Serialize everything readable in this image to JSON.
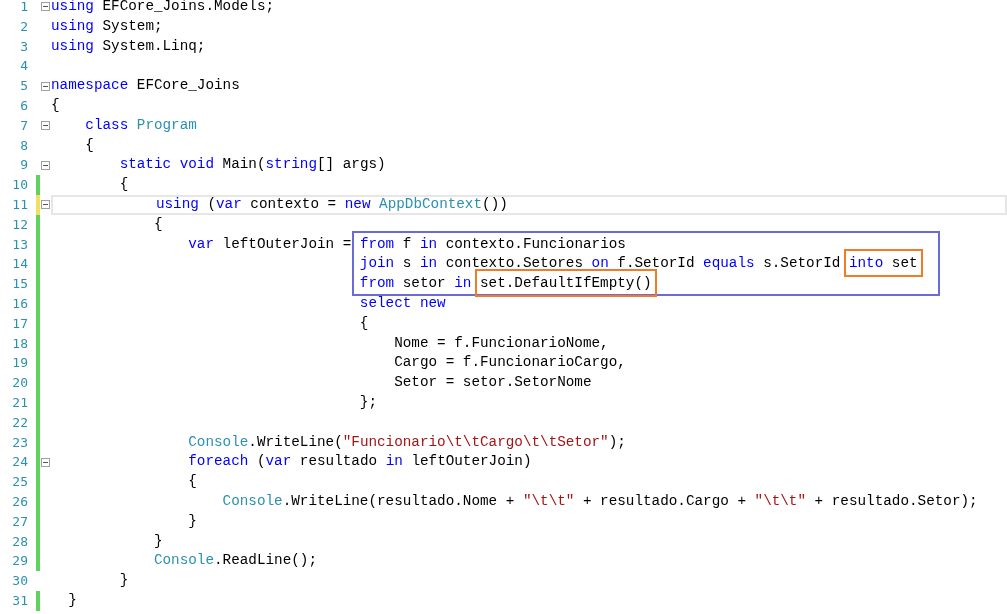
{
  "highlights": [
    {
      "kind": "frame",
      "color": "#6b6bd8"
    },
    {
      "kind": "box",
      "color": "#f07c28"
    }
  ],
  "lines": [
    {
      "number": "1",
      "fold": true,
      "current": false,
      "tokens": [
        {
          "text": "using",
          "kind": "kw"
        },
        {
          "text": " EFCore_Joins.Models;",
          "kind": "plain"
        }
      ]
    },
    {
      "number": "2",
      "fold": false,
      "current": false,
      "tokens": [
        {
          "text": "using",
          "kind": "kw"
        },
        {
          "text": " System;",
          "kind": "plain"
        }
      ]
    },
    {
      "number": "3",
      "fold": false,
      "current": false,
      "tokens": [
        {
          "text": "using",
          "kind": "kw"
        },
        {
          "text": " System.Linq;",
          "kind": "plain"
        }
      ]
    },
    {
      "number": "4",
      "fold": false,
      "current": false
    },
    {
      "number": "5",
      "fold": true,
      "current": false,
      "tokens": [
        {
          "text": "namespace",
          "kind": "kw"
        },
        {
          "text": " EFCore_Joins",
          "kind": "plain"
        }
      ]
    },
    {
      "number": "6",
      "fold": false,
      "current": false,
      "tokens": [
        {
          "text": "{",
          "kind": "plain"
        }
      ]
    },
    {
      "number": "7",
      "fold": true,
      "current": false,
      "tokens": [
        {
          "text": "    class",
          "kind": "kw"
        },
        {
          "text": " Program",
          "kind": "type"
        }
      ]
    },
    {
      "number": "8",
      "fold": false,
      "current": false,
      "tokens": [
        {
          "text": "    {",
          "kind": "plain"
        }
      ]
    },
    {
      "number": "9",
      "fold": true,
      "current": false,
      "tokens": [
        {
          "text": "        static",
          "kind": "kw"
        },
        {
          "text": " void",
          "kind": "kw"
        },
        {
          "text": " Main(",
          "kind": "plain"
        },
        {
          "text": "string",
          "kind": "kw"
        },
        {
          "text": "[] args)",
          "kind": "plain"
        }
      ]
    },
    {
      "number": "10",
      "fold": false,
      "current": false,
      "color": "#5fd35f",
      "tokens": [
        {
          "text": "        {",
          "kind": "plain"
        }
      ]
    },
    {
      "number": "11",
      "fold": true,
      "current": true,
      "color": "#f0e060",
      "tokens": [
        {
          "text": "            using",
          "kind": "kw"
        },
        {
          "text": " (",
          "kind": "plain"
        },
        {
          "text": "var",
          "kind": "kw"
        },
        {
          "text": " contexto = ",
          "kind": "plain"
        },
        {
          "text": "new",
          "kind": "kw"
        },
        {
          "text": " AppDbContext",
          "kind": "type"
        },
        {
          "text": "())",
          "kind": "plain"
        }
      ]
    },
    {
      "number": "12",
      "fold": false,
      "current": false,
      "color": "#5fd35f",
      "tokens": [
        {
          "text": "            {",
          "kind": "plain"
        }
      ]
    },
    {
      "number": "13",
      "fold": false,
      "current": false,
      "color": "#5fd35f",
      "tokens": [
        {
          "text": "                var",
          "kind": "kw"
        },
        {
          "text": " leftOuterJoin = ",
          "kind": "plain"
        }
      ],
      "framed_tokens": [
        {
          "text": "from",
          "kind": "kw"
        },
        {
          "text": " f ",
          "kind": "plain"
        },
        {
          "text": "in",
          "kind": "kw"
        },
        {
          "text": " contexto.Funcionarios",
          "kind": "plain"
        }
      ]
    },
    {
      "number": "14",
      "fold": false,
      "current": false,
      "color": "#5fd35f",
      "framed_tokens": [
        {
          "text": "                                    join",
          "kind": "kw"
        },
        {
          "text": " s ",
          "kind": "plain"
        },
        {
          "text": "in",
          "kind": "kw"
        },
        {
          "text": " contexto.Setores ",
          "kind": "plain"
        },
        {
          "text": "on",
          "kind": "kw"
        },
        {
          "text": " f.SetorId ",
          "kind": "plain"
        },
        {
          "text": "equals",
          "kind": "kw"
        },
        {
          "text": " s.SetorId ",
          "kind": "plain"
        }
      ],
      "boxed_tokens": [
        {
          "text": "into",
          "kind": "kw"
        },
        {
          "text": " set",
          "kind": "plain"
        }
      ]
    },
    {
      "number": "15",
      "fold": false,
      "current": false,
      "color": "#5fd35f",
      "framed_tokens": [
        {
          "text": "                                    from",
          "kind": "kw"
        },
        {
          "text": " setor ",
          "kind": "plain"
        },
        {
          "text": "in ",
          "kind": "kw"
        }
      ],
      "boxed_tokens": [
        {
          "text": "set.DefaultIfEmpty()",
          "kind": "plain"
        }
      ]
    },
    {
      "number": "16",
      "fold": false,
      "current": false,
      "color": "#5fd35f",
      "tokens": [
        {
          "text": "                                    select",
          "kind": "kw"
        },
        {
          "text": " new",
          "kind": "kw"
        }
      ]
    },
    {
      "number": "17",
      "fold": false,
      "current": false,
      "color": "#5fd35f",
      "tokens": [
        {
          "text": "                                    {",
          "kind": "plain"
        }
      ]
    },
    {
      "number": "18",
      "fold": false,
      "current": false,
      "color": "#5fd35f",
      "tokens": [
        {
          "text": "                                        Nome = f.FuncionarioNome,",
          "kind": "plain"
        }
      ]
    },
    {
      "number": "19",
      "fold": false,
      "current": false,
      "color": "#5fd35f",
      "tokens": [
        {
          "text": "                                        Cargo = f.FuncionarioCargo,",
          "kind": "plain"
        }
      ]
    },
    {
      "number": "20",
      "fold": false,
      "current": false,
      "color": "#5fd35f",
      "tokens": [
        {
          "text": "                                        Setor = setor.SetorNome",
          "kind": "plain"
        }
      ]
    },
    {
      "number": "21",
      "fold": false,
      "current": false,
      "color": "#5fd35f",
      "tokens": [
        {
          "text": "                                    };",
          "kind": "plain"
        }
      ]
    },
    {
      "number": "22",
      "fold": false,
      "current": false,
      "color": "#5fd35f"
    },
    {
      "number": "23",
      "fold": false,
      "current": false,
      "color": "#5fd35f",
      "tokens": [
        {
          "text": "                Console",
          "kind": "type"
        },
        {
          "text": ".WriteLine(",
          "kind": "plain"
        },
        {
          "text": "\"Funcionario\\t\\tCargo\\t\\tSetor\"",
          "kind": "str"
        },
        {
          "text": ");",
          "kind": "plain"
        }
      ]
    },
    {
      "number": "24",
      "fold": true,
      "current": false,
      "color": "#5fd35f",
      "tokens": [
        {
          "text": "                foreach",
          "kind": "kw"
        },
        {
          "text": " (",
          "kind": "plain"
        },
        {
          "text": "var",
          "kind": "kw"
        },
        {
          "text": " resultado ",
          "kind": "plain"
        },
        {
          "text": "in",
          "kind": "kw"
        },
        {
          "text": " leftOuterJoin)",
          "kind": "plain"
        }
      ]
    },
    {
      "number": "25",
      "fold": false,
      "current": false,
      "color": "#5fd35f",
      "tokens": [
        {
          "text": "                {",
          "kind": "plain"
        }
      ]
    },
    {
      "number": "26",
      "fold": false,
      "current": false,
      "color": "#5fd35f",
      "tokens": [
        {
          "text": "                    Console",
          "kind": "type"
        },
        {
          "text": ".WriteLine(resultado.Nome + ",
          "kind": "plain"
        },
        {
          "text": "\"\\t\\t\"",
          "kind": "str"
        },
        {
          "text": " + resultado.Cargo + ",
          "kind": "plain"
        },
        {
          "text": "\"\\t\\t\"",
          "kind": "str"
        },
        {
          "text": " + resultado.Setor);",
          "kind": "plain"
        }
      ]
    },
    {
      "number": "27",
      "fold": false,
      "current": false,
      "color": "#5fd35f",
      "tokens": [
        {
          "text": "                }",
          "kind": "plain"
        }
      ]
    },
    {
      "number": "28",
      "fold": false,
      "current": false,
      "color": "#5fd35f",
      "tokens": [
        {
          "text": "            }",
          "kind": "plain"
        }
      ]
    },
    {
      "number": "29",
      "fold": false,
      "current": false,
      "color": "#5fd35f",
      "tokens": [
        {
          "text": "            Console",
          "kind": "type"
        },
        {
          "text": ".ReadLine();",
          "kind": "plain"
        }
      ]
    },
    {
      "number": "30",
      "fold": false,
      "current": false,
      "tokens": [
        {
          "text": "        }",
          "kind": "plain"
        }
      ]
    },
    {
      "number": "31",
      "fold": false,
      "current": false,
      "color": "#5fd35f",
      "tokens": [
        {
          "text": "  }",
          "kind": "plain"
        }
      ]
    }
  ]
}
